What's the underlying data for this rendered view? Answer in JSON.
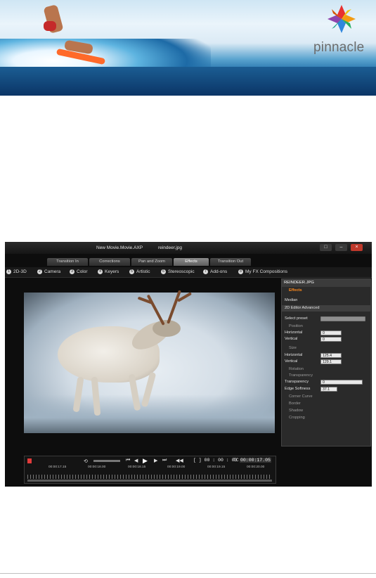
{
  "banner": {
    "logo_text": "pinnacle"
  },
  "window": {
    "project_title": "New Movie.Movie.AXP",
    "file_title": "reindeer.jpg"
  },
  "window_buttons": [
    "□",
    "–",
    "×"
  ],
  "effect_tabs": [
    {
      "label": "Transition In"
    },
    {
      "label": "Corrections"
    },
    {
      "label": "Pan and Zoom"
    },
    {
      "label": "Effects"
    },
    {
      "label": "Transition Out"
    }
  ],
  "categories": [
    {
      "num": "1",
      "label": "2D-3D"
    },
    {
      "num": "2",
      "label": "Camera"
    },
    {
      "num": "3",
      "label": "Color"
    },
    {
      "num": "4",
      "label": "Keyers"
    },
    {
      "num": "5",
      "label": "Artistic"
    },
    {
      "num": "6",
      "label": "Stereoscopic"
    },
    {
      "num": "7",
      "label": "Add-ons"
    },
    {
      "num": "8",
      "label": "My FX Compositions"
    }
  ],
  "panel": {
    "file": "REINDEER.JPG",
    "effects_label": "Effects",
    "effect1": "Median",
    "effect2": "2D Editor Advanced",
    "select_preset": "Select preset",
    "position_section": "Position",
    "horizontal_label": "Horizontal",
    "horizontal_value": "0",
    "vertical_label": "Vertical",
    "vertical_value": "0",
    "size_section": "Size",
    "size_horizontal_label": "Horizontal",
    "size_horizontal_value": "125.4",
    "size_vertical_label": "Vertical",
    "size_vertical_value": "129.1",
    "rotation": "Rotation",
    "transparency_section": "Transparency",
    "transparency_label": "Transparency",
    "transparency_value": "0",
    "edge_softness_label": "Edge Softness",
    "edge_softness_value": "37.1",
    "corner_curve": "Corner Curve",
    "border": "Border",
    "shadow": "Shadow",
    "cropping": "Cropping"
  },
  "timeline": {
    "timecode": "[ ] 00 : 00 : 03 : 00",
    "tc_label": "TC",
    "tc_value": "00:00:17.05",
    "ticks": [
      "00:00:17.15",
      "00:00:18.00",
      "00:00:18.15",
      "00:00:19.00",
      "00:00:19.15",
      "00:00:20.00"
    ]
  }
}
